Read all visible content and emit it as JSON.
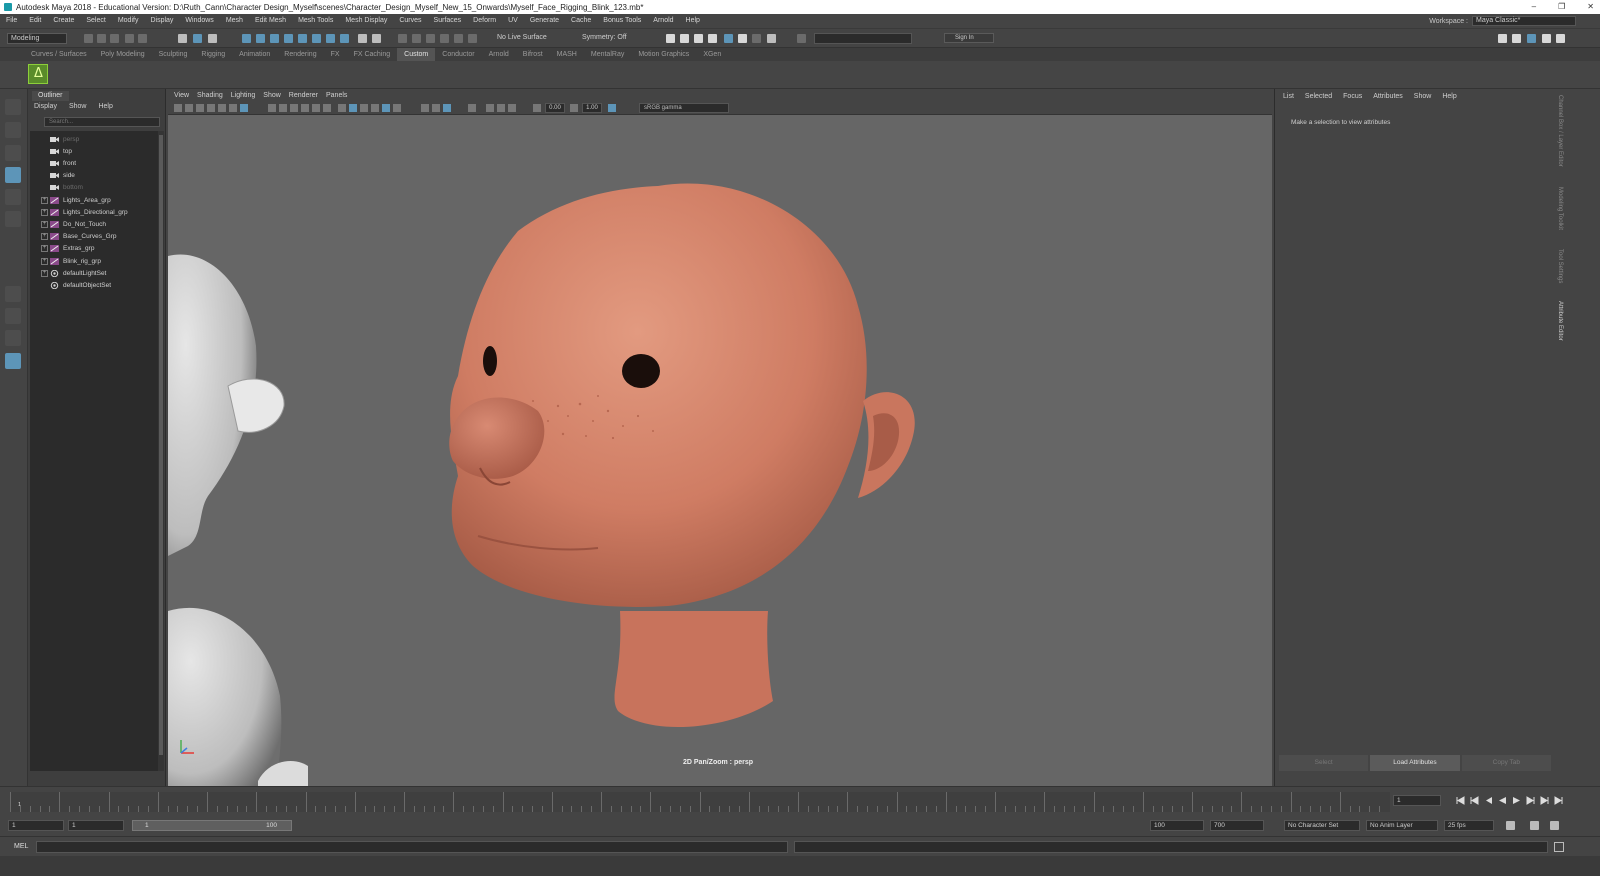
{
  "window": {
    "title": "Autodesk Maya 2018 - Educational Version: D:\\Ruth_Cann\\Character Design_Myself\\scenes\\Character_Design_Myself_New_15_Onwards\\Myself_Face_Rigging_Blink_123.mb*",
    "controls": [
      "–",
      "❐",
      "✕"
    ]
  },
  "menubar": {
    "items": [
      "File",
      "Edit",
      "Create",
      "Select",
      "Modify",
      "Display",
      "Windows",
      "Mesh",
      "Edit Mesh",
      "Mesh Tools",
      "Mesh Display",
      "Curves",
      "Surfaces",
      "Deform",
      "UV",
      "Generate",
      "Cache",
      "Bonus Tools",
      "Arnold",
      "Help"
    ],
    "workspace_label": "Workspace :",
    "workspace_value": "Maya Classic*"
  },
  "statusline": {
    "mode": "Modeling",
    "live_surface": "No Live Surface",
    "symmetry": "Symmetry: Off",
    "sign_in": "Sign In"
  },
  "shelf": {
    "tabs": [
      "Curves / Surfaces",
      "Poly Modeling",
      "Sculpting",
      "Rigging",
      "Animation",
      "Rendering",
      "FX",
      "FX Caching",
      "Custom",
      "Conductor",
      "Arnold",
      "Bifrost",
      "MASH",
      "MentalRay",
      "Motion Graphics",
      "XGen"
    ],
    "active_tab": "Custom",
    "bifrost_icon": "bifrost-icon"
  },
  "outliner": {
    "title": "Outliner",
    "menu": [
      "Display",
      "Show",
      "Help"
    ],
    "search_placeholder": "Search...",
    "items": [
      {
        "label": "persp",
        "kind": "camera",
        "dim": true,
        "expand": false
      },
      {
        "label": "top",
        "kind": "camera",
        "dim": false,
        "expand": false
      },
      {
        "label": "front",
        "kind": "camera",
        "dim": false,
        "expand": false
      },
      {
        "label": "side",
        "kind": "camera",
        "dim": false,
        "expand": false
      },
      {
        "label": "bottom",
        "kind": "camera",
        "dim": true,
        "expand": false
      },
      {
        "label": "Lights_Area_grp",
        "kind": "group",
        "dim": false,
        "expand": true
      },
      {
        "label": "Lights_Directional_grp",
        "kind": "group",
        "dim": false,
        "expand": true
      },
      {
        "label": "Do_Not_Touch",
        "kind": "group",
        "dim": false,
        "expand": true
      },
      {
        "label": "Base_Curves_Grp",
        "kind": "group",
        "dim": false,
        "expand": true
      },
      {
        "label": "Extras_grp",
        "kind": "group",
        "dim": false,
        "expand": true
      },
      {
        "label": "Blink_rig_grp",
        "kind": "group",
        "dim": false,
        "expand": true
      },
      {
        "label": "defaultLightSet",
        "kind": "set",
        "dim": false,
        "expand": true
      },
      {
        "label": "defaultObjectSet",
        "kind": "set",
        "dim": false,
        "expand": false
      }
    ]
  },
  "viewport": {
    "menu": [
      "View",
      "Shading",
      "Lighting",
      "Show",
      "Renderer",
      "Panels"
    ],
    "exposure": "0.00",
    "gamma": "1.00",
    "color_space": "sRGB gamma",
    "camera_label": "2D Pan/Zoom : persp",
    "colors": {
      "background": "#666666",
      "skin": "#d98a70",
      "grey_model": "#cfcfcf"
    }
  },
  "attribute_editor": {
    "menu": [
      "List",
      "Selected",
      "Focus",
      "Attributes",
      "Show",
      "Help"
    ],
    "hint": "Make a selection to view attributes",
    "buttons": [
      "Select",
      "Load Attributes",
      "Copy Tab"
    ],
    "active_button": "Load Attributes"
  },
  "side_tabs": [
    "Channel Box / Layer Editor",
    "Modeling Toolkit",
    "Tool Settings",
    "Attribute Editor"
  ],
  "timeslider": {
    "current_frame": "1",
    "start_marker": "1"
  },
  "rangeslider": {
    "start": "1",
    "playback_start": "1",
    "bar_left": "1",
    "bar_right": "100",
    "playback_end": "100",
    "end": "700",
    "character_set": "No Character Set",
    "anim_layer": "No Anim Layer",
    "fps": "25 fps"
  },
  "cmdline": {
    "label": "MEL"
  }
}
